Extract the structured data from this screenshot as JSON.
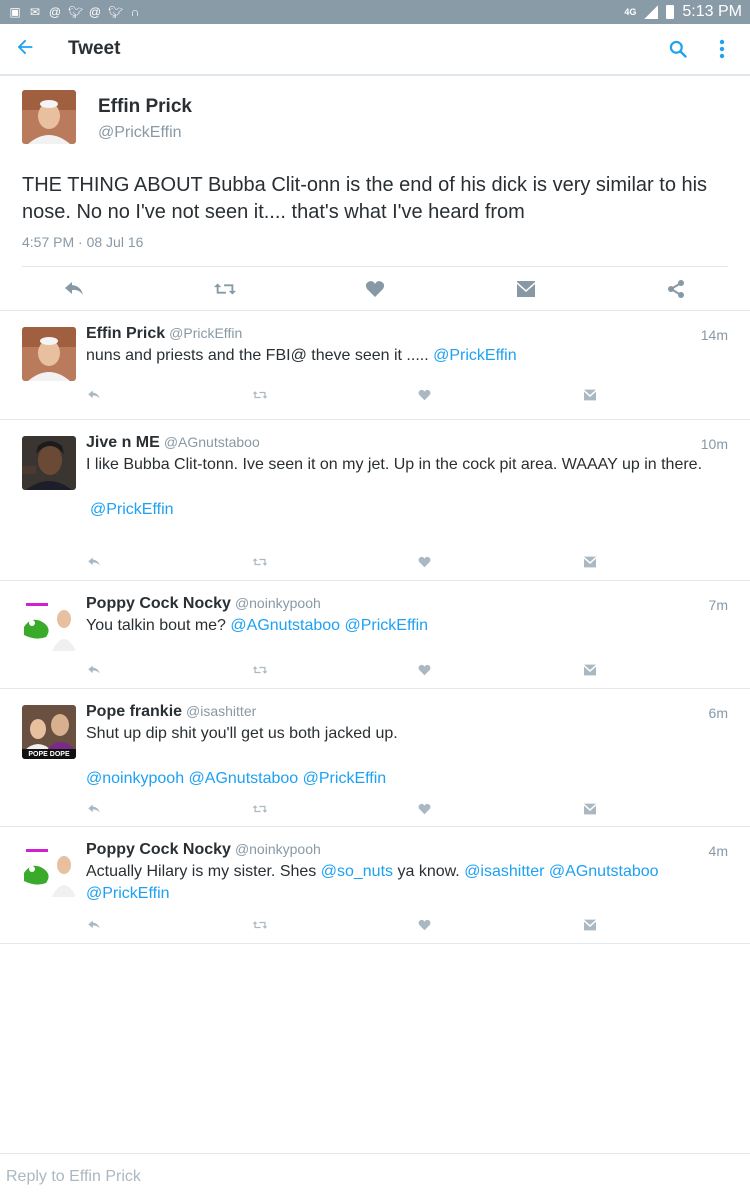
{
  "status_bar": {
    "network": "4G",
    "time": "5:13 PM"
  },
  "header": {
    "title": "Tweet"
  },
  "main_tweet": {
    "name": "Effin Prick",
    "handle": "@PrickEffin",
    "text": "THE THING ABOUT Bubba Clit-onn is the end of his dick is very similar to his nose.  No no I've not seen it.... that's what I've heard from",
    "timestamp": "4:57 PM · 08 Jul 16"
  },
  "replies": [
    {
      "name": "Effin Prick",
      "handle": "@PrickEffin",
      "time": "14m",
      "text": "nuns and priests and the  FBI@  theve seen it .....",
      "mention_inline": "@PrickEffin"
    },
    {
      "name": "Jive n ME",
      "handle": "@AGnutstaboo",
      "time": "10m",
      "text": "I like Bubba Clit-tonn.  Ive seen it on my jet. Up in the cock pit area.  WAAAY up in there.",
      "mention_line": "@PrickEffin"
    },
    {
      "name": "Poppy Cock Nocky",
      "handle": "@noinkypooh",
      "time": "7m",
      "text": "You talkin bout me?",
      "mention_a": "@AGnutstaboo",
      "mention_b": "@PrickEffin"
    },
    {
      "name": "Pope frankie",
      "handle": "@isashitter",
      "time": "6m",
      "text": "Shut up dip shit you'll get us both jacked up.",
      "mention_a": "@noinkypooh",
      "mention_b": "@AGnutstaboo",
      "mention_c": "@PrickEffin",
      "avatar_caption": "POPE DOPE"
    },
    {
      "name": "Poppy Cock Nocky",
      "handle": "@noinkypooh",
      "time": "4m",
      "text_a": "Actually Hilary is my sister.  Shes",
      "mention_a": "@so_nuts",
      "text_b": "ya know.",
      "mention_b": "@isashitter",
      "mention_c": "@AGnutstaboo",
      "mention_d": "@PrickEffin"
    }
  ],
  "composer": {
    "placeholder": "Reply to Effin Prick"
  },
  "colors": {
    "accent": "#1da1f2",
    "muted": "#8899a6",
    "icon": "#8899a6",
    "text": "#292f33",
    "divider": "#e1e8ed"
  },
  "icons": [
    "back-arrow-icon",
    "search-icon",
    "more-vert-icon",
    "reply-icon",
    "retweet-icon",
    "like-icon",
    "dm-icon",
    "share-icon"
  ]
}
